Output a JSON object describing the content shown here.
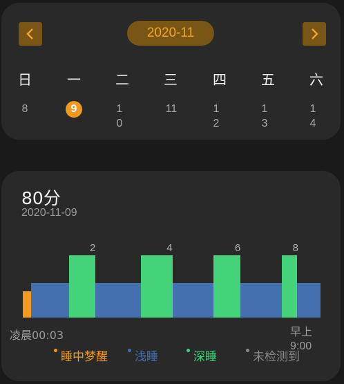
{
  "calendar": {
    "month_label": "2020-11",
    "prev_icon": "chevron-left-icon",
    "next_icon": "chevron-right-icon",
    "weekdays": [
      "日",
      "一",
      "二",
      "三",
      "四",
      "五",
      "六"
    ],
    "days": [
      "8",
      "9",
      "10",
      "11",
      "12",
      "13",
      "14"
    ],
    "selected_day": "9",
    "accent_color": "#f19a1e"
  },
  "sleep": {
    "score": "80分",
    "date": "2020-11-09",
    "start_time": "凌晨00:03",
    "end_time": "早上9:00",
    "legend": [
      {
        "label": "睡中梦醒",
        "color": "#f19a1e"
      },
      {
        "label": "浅睡",
        "color": "#4470b0"
      },
      {
        "label": "深睡",
        "color": "#45d37a"
      },
      {
        "label": "未检测到",
        "color": "#8a8a8a"
      }
    ]
  },
  "chart_data": {
    "type": "bar",
    "stages": [
      "睡中梦醒",
      "浅睡",
      "深睡",
      "浅睡",
      "深睡",
      "浅睡",
      "深睡",
      "浅睡",
      "深睡",
      "浅睡"
    ],
    "stage_levels": {
      "睡中梦醒": 1,
      "浅睡": 2,
      "深睡": 3
    },
    "deep_sleep_labels": [
      "2",
      "4",
      "6",
      "8"
    ],
    "x_labels": [
      "凌晨00:03",
      "早上9:00"
    ],
    "colors": {
      "睡中梦醒": "#f19a1e",
      "浅睡": "#4470b0",
      "深睡": "#45d37a"
    }
  }
}
